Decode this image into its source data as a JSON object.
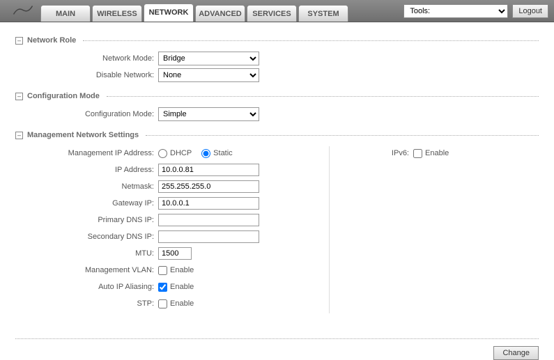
{
  "header": {
    "tabs": [
      "MAIN",
      "WIRELESS",
      "NETWORK",
      "ADVANCED",
      "SERVICES",
      "SYSTEM"
    ],
    "active_tab": "NETWORK",
    "tools_label": "Tools:",
    "logout": "Logout"
  },
  "sections": {
    "network_role": {
      "title": "Network Role",
      "network_mode_label": "Network Mode:",
      "network_mode_value": "Bridge",
      "disable_network_label": "Disable Network:",
      "disable_network_value": "None"
    },
    "config_mode": {
      "title": "Configuration Mode",
      "config_mode_label": "Configuration Mode:",
      "config_mode_value": "Simple"
    },
    "mgmt": {
      "title": "Management Network Settings",
      "mgmt_ip_label": "Management IP Address:",
      "dhcp": "DHCP",
      "static": "Static",
      "selected": "static",
      "ip_address_label": "IP Address:",
      "ip_address_value": "10.0.0.81",
      "netmask_label": "Netmask:",
      "netmask_value": "255.255.255.0",
      "gateway_label": "Gateway IP:",
      "gateway_value": "10.0.0.1",
      "primary_dns_label": "Primary DNS IP:",
      "primary_dns_value": "",
      "secondary_dns_label": "Secondary DNS IP:",
      "secondary_dns_value": "",
      "mtu_label": "MTU:",
      "mtu_value": "1500",
      "vlan_label": "Management VLAN:",
      "vlan_enable": "Enable",
      "vlan_checked": false,
      "autoip_label": "Auto IP Aliasing:",
      "autoip_enable": "Enable",
      "autoip_checked": true,
      "stp_label": "STP:",
      "stp_enable": "Enable",
      "stp_checked": false,
      "ipv6_label": "IPv6:",
      "ipv6_enable": "Enable",
      "ipv6_checked": false
    }
  },
  "footer": {
    "change": "Change"
  },
  "toggle_symbol": "–"
}
